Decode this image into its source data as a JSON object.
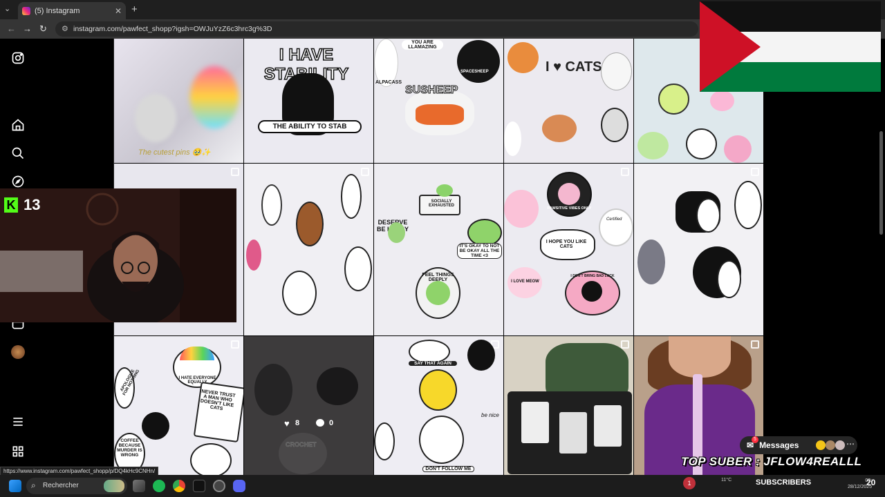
{
  "browser": {
    "tab_title": "(5) Instagram",
    "url": "instagram.com/pawfect_shopp?igsh=OWJuYzZ6c3hrc3g%3D",
    "status_url": "https://www.instagram.com/pawfect_shopp/p/DQ4kHc9CNHn/"
  },
  "sidebar": {
    "items": [
      "instagram-logo",
      "home-icon",
      "search-icon",
      "explore-icon",
      "reels-icon",
      "profile-avatar",
      "more-menu-icon",
      "meta-apps-icon"
    ]
  },
  "stream": {
    "kick_count": "13",
    "top_suber": "TOP SUBER : JFLOW4REALLL",
    "subscribers_label": "SUBSCRIBERS"
  },
  "posts": {
    "row1": {
      "c1_caption": "The cutest pins 🥹✨",
      "c2_text_top": "I HAVE STABILITY",
      "c2_text_bottom": "THE ABILITY TO STAB",
      "c3_text1": "SUSHEEP",
      "c3_text2": "SPACESHEEP",
      "c3_text3": "ALPACASS",
      "c3_text4": "YOU ARE LLAMAZING",
      "c4_text": "I ♥ CATS"
    },
    "row2": {
      "c3_text1": "SOCIALLY EXHAUSTED",
      "c3_text2": "DESERVE BE HAPPY",
      "c3_text3": "IT'S OKAY TO NOT BE OKAY ALL THE TIME <3",
      "c3_text4": "FEEL THINGS DEEPLY",
      "c4_text1": "PAWSITIVE VIBES ONLY",
      "c4_text2": "I HOPE YOU LIKE CATS",
      "c4_text3": "I LOVE MEOW",
      "c4_text4": "I DON'T BRING BAD LUCK",
      "c4_text5": "Certified"
    },
    "row3": {
      "c1_text1": "I HATE EVERYONE EQUALLY",
      "c1_text2": "NEVER TRUST A MAN WHO DOESN'T LIKE CATS",
      "c1_text3": "APOLOGIZE FOR NOTHING",
      "c1_text4": "COFFEE BECAUSE MURDER IS WRONG",
      "c2_likes": "8",
      "c2_comments": "0",
      "c2_text": "CROCHET",
      "c3_text1": "SAY THAT AGAIN",
      "c3_text2": "DON'T FOLLOW ME",
      "c3_text3": "be nice"
    }
  },
  "messages": {
    "label": "Messages",
    "badge": "5"
  },
  "taskbar": {
    "search_placeholder": "Rechercher",
    "notification_count": "1",
    "temperature": "11°C",
    "time_small": "03:",
    "time_big": "20",
    "date": "28/12/2025"
  },
  "colors": {
    "kick_green": "#53fc18",
    "badge_red": "#ff3040",
    "palestine_red": "#ce1126",
    "palestine_green": "#007a3d"
  }
}
